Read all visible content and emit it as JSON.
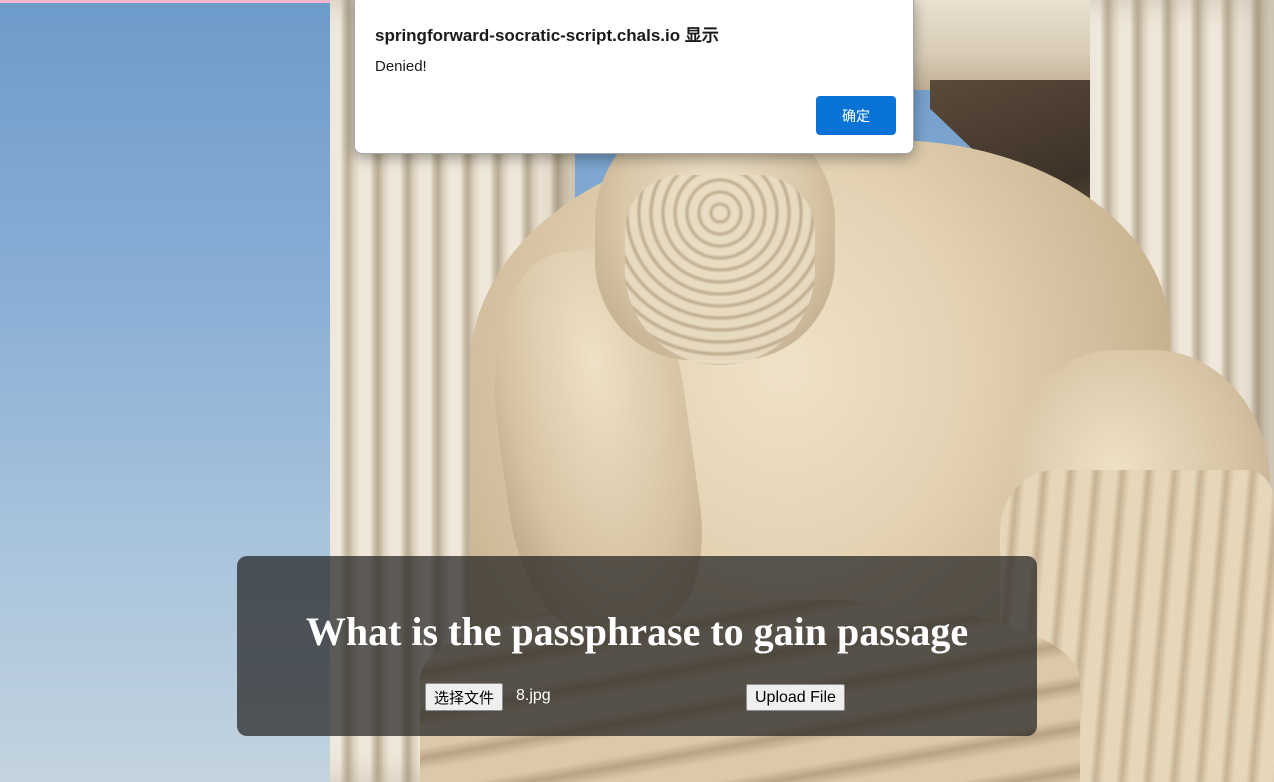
{
  "dialog": {
    "title": "springforward-socratic-script.chals.io 显示",
    "message": "Denied!",
    "ok_label": "确定",
    "accent_color": "#0a73d6"
  },
  "form": {
    "heading": "What is the passphrase to gain passage",
    "choose_file_label": "选择文件",
    "selected_file": "8.jpg",
    "upload_label": "Upload File"
  },
  "background": {
    "description_colors": [
      "#6d9bc9",
      "#efe7d9",
      "#e3d1b2"
    ]
  }
}
